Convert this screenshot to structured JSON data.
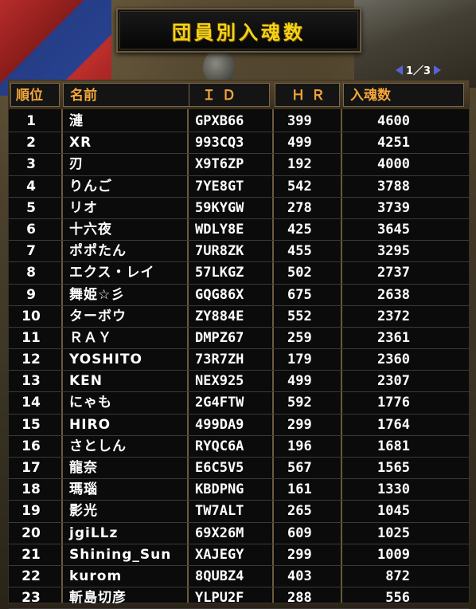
{
  "title": "団員別入魂数",
  "pager": {
    "text": "1／3"
  },
  "colors": {
    "title": "#f4d31a",
    "header": "#f4a63a",
    "arrow": "#5a62d8"
  },
  "table": {
    "headers": {
      "rank": "順位",
      "name": "名前",
      "id": "ＩＤ",
      "hr": "ＨＲ",
      "souls": "入魂数"
    },
    "rows": [
      {
        "rank": "1",
        "name": "漣",
        "id": "GPXB66",
        "hr": "399",
        "souls": "4600"
      },
      {
        "rank": "2",
        "name": "XR",
        "id": "993CQ3",
        "hr": "499",
        "souls": "4251"
      },
      {
        "rank": "3",
        "name": "刃",
        "id": "X9T6ZP",
        "hr": "192",
        "souls": "4000"
      },
      {
        "rank": "4",
        "name": "りんご",
        "id": "7YE8GT",
        "hr": "542",
        "souls": "3788"
      },
      {
        "rank": "5",
        "name": "リオ",
        "id": "59KYGW",
        "hr": "278",
        "souls": "3739"
      },
      {
        "rank": "6",
        "name": "十六夜",
        "id": "WDLY8E",
        "hr": "425",
        "souls": "3645"
      },
      {
        "rank": "7",
        "name": "ポポたん",
        "id": "7UR8ZK",
        "hr": "455",
        "souls": "3295"
      },
      {
        "rank": "8",
        "name": "エクス・レイ",
        "id": "57LKGZ",
        "hr": "502",
        "souls": "2737"
      },
      {
        "rank": "9",
        "name": "舞姫☆彡",
        "id": "GQG86X",
        "hr": "675",
        "souls": "2638"
      },
      {
        "rank": "10",
        "name": "ターボウ",
        "id": "ZY884E",
        "hr": "552",
        "souls": "2372"
      },
      {
        "rank": "11",
        "name": "ＲＡＹ",
        "id": "DMPZ67",
        "hr": "259",
        "souls": "2361"
      },
      {
        "rank": "12",
        "name": "YOSHITO",
        "id": "73R7ZH",
        "hr": "179",
        "souls": "2360"
      },
      {
        "rank": "13",
        "name": "KEN",
        "id": "NEX925",
        "hr": "499",
        "souls": "2307"
      },
      {
        "rank": "14",
        "name": "にゃも",
        "id": "2G4FTW",
        "hr": "592",
        "souls": "1776"
      },
      {
        "rank": "15",
        "name": "HIRO",
        "id": "499DA9",
        "hr": "299",
        "souls": "1764"
      },
      {
        "rank": "16",
        "name": "さとしん",
        "id": "RYQC6A",
        "hr": "196",
        "souls": "1681"
      },
      {
        "rank": "17",
        "name": "龍奈",
        "id": "E6C5V5",
        "hr": "567",
        "souls": "1565"
      },
      {
        "rank": "18",
        "name": "瑪瑙",
        "id": "KBDPNG",
        "hr": "161",
        "souls": "1330"
      },
      {
        "rank": "19",
        "name": "影光",
        "id": "TW7ALT",
        "hr": "265",
        "souls": "1045"
      },
      {
        "rank": "20",
        "name": "jgiLLz",
        "id": "69X26M",
        "hr": "609",
        "souls": "1025"
      },
      {
        "rank": "21",
        "name": "Shining_Sun",
        "id": "XAJEGY",
        "hr": "299",
        "souls": "1009"
      },
      {
        "rank": "22",
        "name": "kurom",
        "id": "8QUBZ4",
        "hr": "403",
        "souls": "872"
      },
      {
        "rank": "23",
        "name": "斬島切彦",
        "id": "YLPU2F",
        "hr": "288",
        "souls": "556"
      }
    ]
  }
}
